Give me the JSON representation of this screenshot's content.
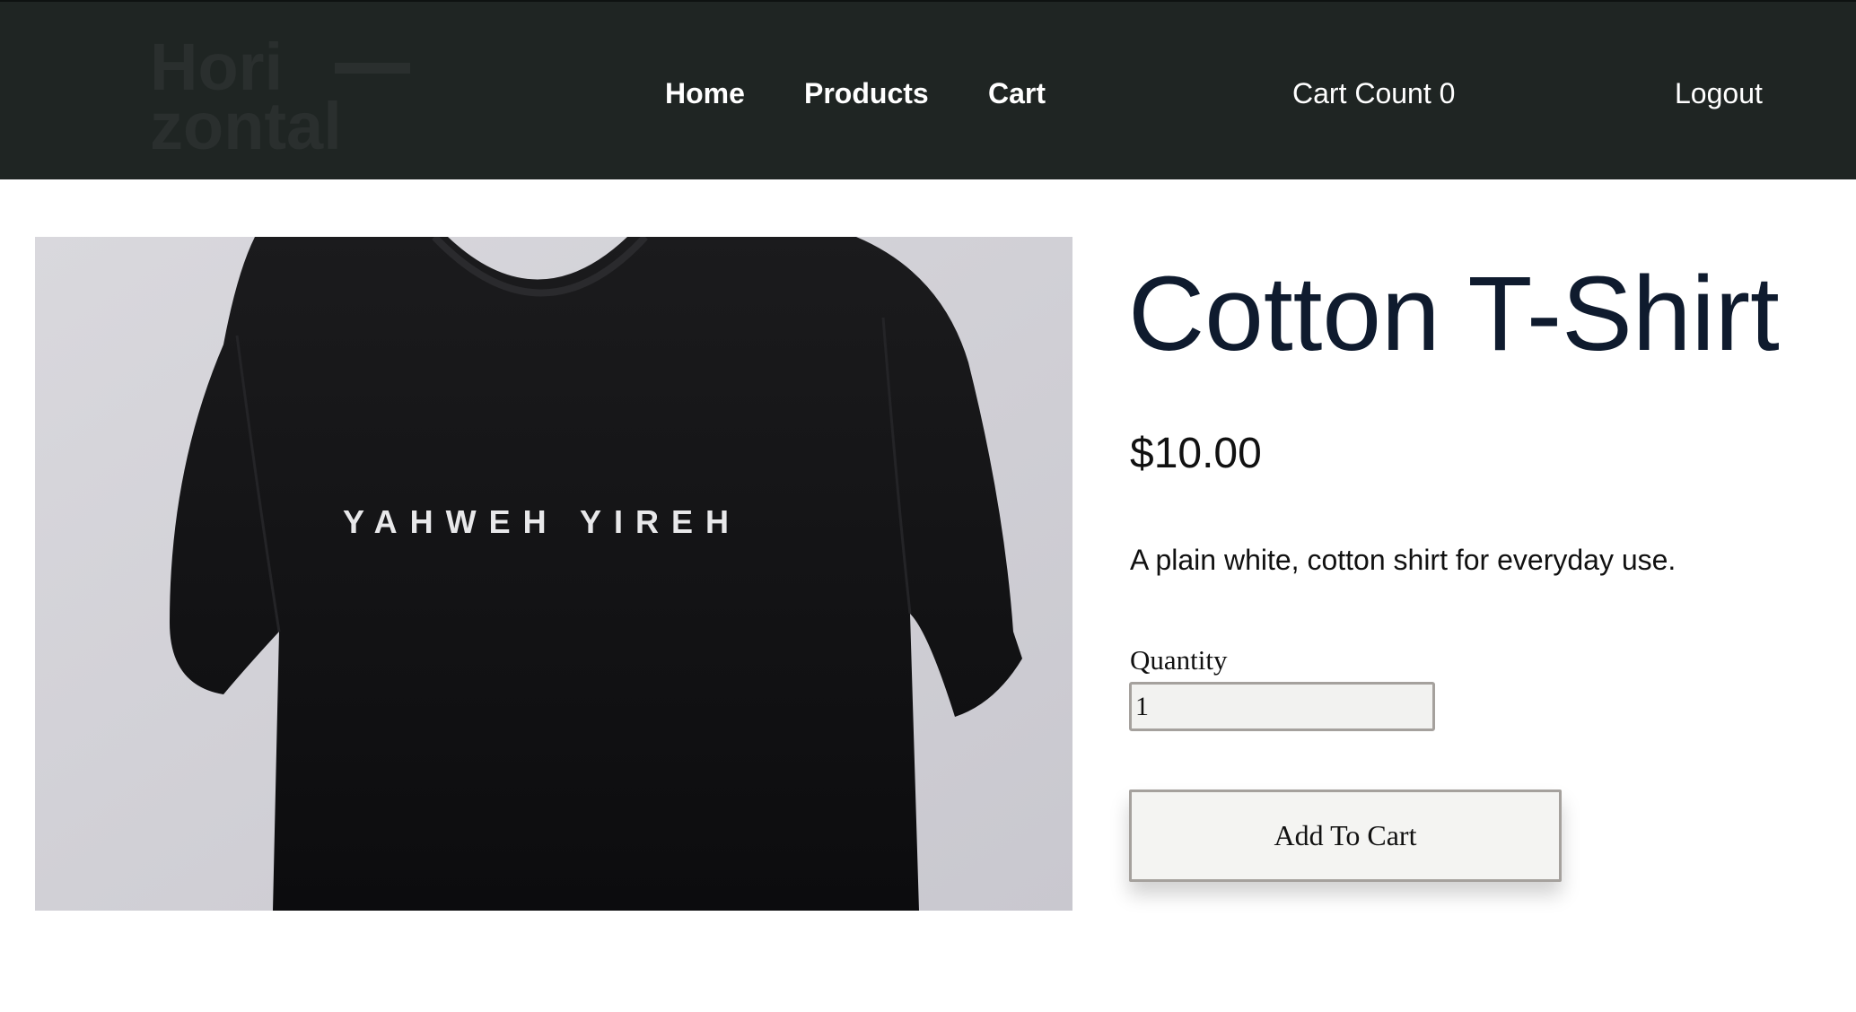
{
  "header": {
    "logo_text_line1": "Hori",
    "logo_text_line2": "zontal",
    "nav": {
      "home": "Home",
      "products": "Products",
      "cart": "Cart"
    },
    "cart_count_label": "Cart Count 0",
    "logout_label": "Logout"
  },
  "product": {
    "image_icon": "tshirt-photo",
    "shirt_print": "YAHWEH YIREH",
    "title": "Cotton T-Shirt",
    "price": "$10.00",
    "description": "A plain white, cotton shirt for everyday use.",
    "quantity_label": "Quantity",
    "quantity_value": "1",
    "add_to_cart_label": "Add To Cart"
  },
  "colors": {
    "navbar_bg": "#1f2523",
    "title_text": "#0f1b2e",
    "button_border": "#a5a19d"
  }
}
